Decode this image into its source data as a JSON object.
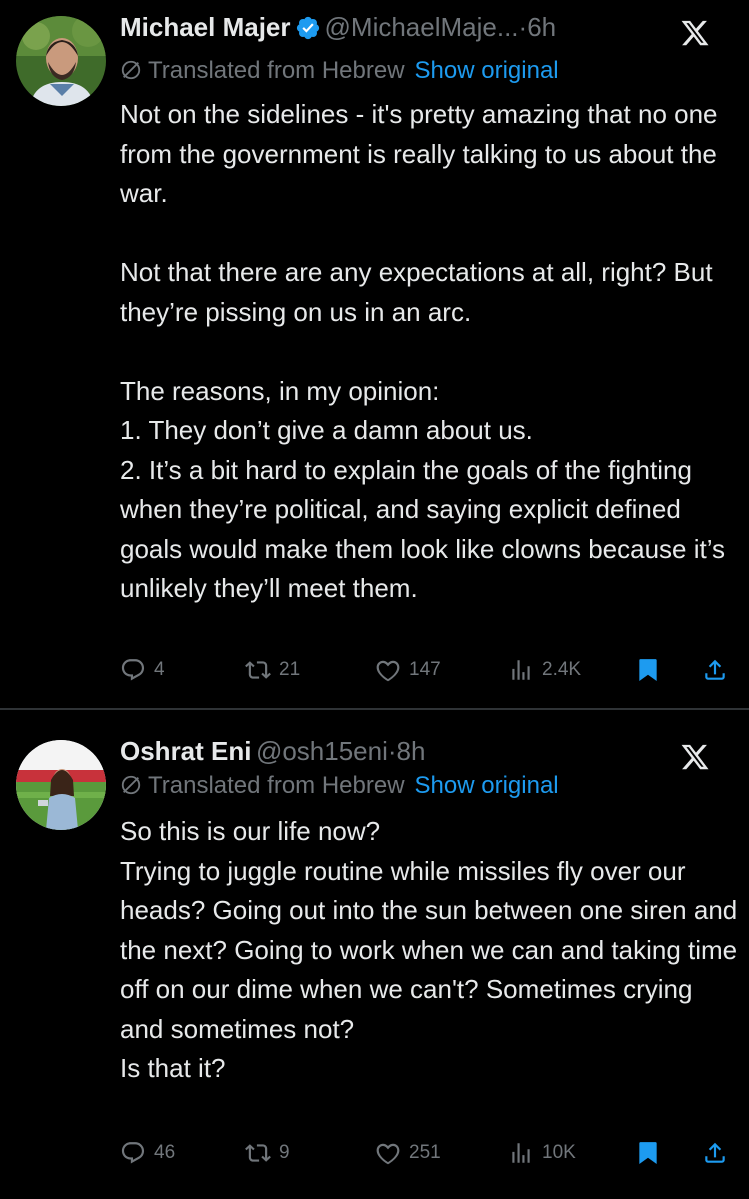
{
  "tweets": [
    {
      "name": "Michael Majer",
      "handle": "@MichaelMaje...",
      "time": "6h",
      "verified": true,
      "translated_label": "Translated from Hebrew",
      "show_original": "Show original",
      "paragraphs": [
        "Not on the sidelines - it's pretty amazing that no one from the government is really talking to us about the war.",
        "Not that there are any expectations at all, right? But they’re pissing on us in an arc.",
        "The reasons, in my opinion:\n1. They don’t give a damn about us.\n2. It’s a bit hard to explain the goals of the fighting when they’re political, and saying explicit defined goals would make them look like clowns because it’s unlikely they’ll meet them."
      ],
      "replies": "4",
      "retweets": "21",
      "likes": "147",
      "views": "2.4K"
    },
    {
      "name": "Oshrat Eni",
      "handle": "@osh15eni",
      "time": "8h",
      "verified": false,
      "translated_label": "Translated from Hebrew",
      "show_original": "Show original",
      "paragraphs": [
        "So this is our life now?\nTrying to juggle routine while missiles fly over our heads? Going out into the sun between one siren and the next? Going to work when we can and taking time off on our dime when we can't? Sometimes crying and sometimes not?\nIs that it?"
      ],
      "replies": "46",
      "retweets": "9",
      "likes": "251",
      "views": "10K"
    }
  ],
  "colors": {
    "accent": "#1d9bf0",
    "muted": "#71767b",
    "text": "#e7e9ea",
    "background": "#000000"
  }
}
